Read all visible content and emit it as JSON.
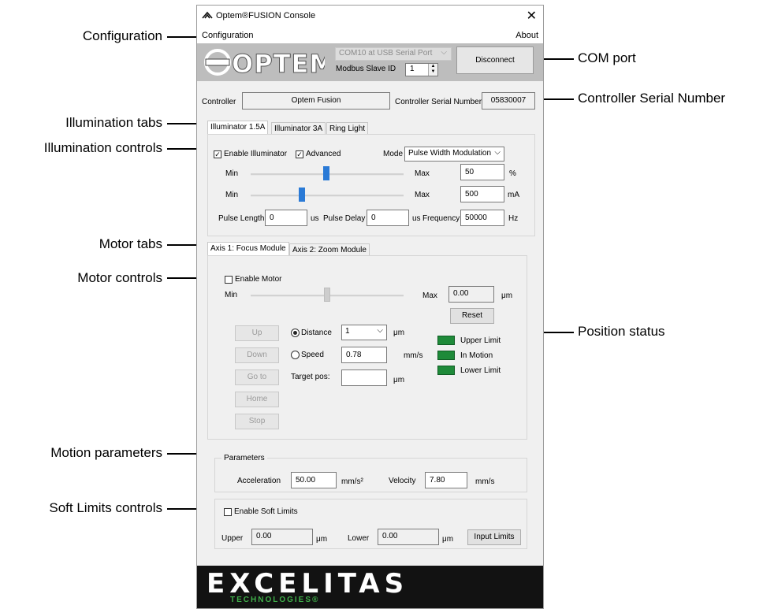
{
  "window": {
    "title": "Optem®FUSION Console",
    "close_glyph": "✕"
  },
  "menu": {
    "configuration": "Configuration",
    "about": "About"
  },
  "header": {
    "logo_text": "OPTEM",
    "com_port": "COM10 at USB Serial Port",
    "slave_id_label": "Modbus Slave ID",
    "slave_id": "1",
    "disconnect": "Disconnect"
  },
  "controller": {
    "label": "Controller",
    "value": "Optem Fusion",
    "serial_label": "Controller Serial Number",
    "serial": "05830007"
  },
  "illumination": {
    "tabs": [
      "Illuminator 1.5A",
      "Illuminator 3A",
      "Ring Light"
    ],
    "enable_label": "Enable Illuminator",
    "advanced_label": "Advanced",
    "mode_label": "Mode",
    "mode": "Pulse Width Modulation",
    "row1": {
      "min": "Min",
      "max": "Max",
      "value": "50",
      "unit": "%",
      "level": 0.5
    },
    "row2": {
      "min": "Min",
      "max": "Max",
      "value": "500",
      "unit": "mA",
      "level": 0.33
    },
    "pulse_length_label": "Pulse Length",
    "pulse_length": "0",
    "pulse_length_unit": "us",
    "pulse_delay_label": "Pulse Delay",
    "pulse_delay": "0",
    "pulse_delay_unit": "us",
    "frequency_label": "Frequency",
    "frequency": "50000",
    "frequency_unit": "Hz"
  },
  "motor": {
    "tabs": [
      "Axis 1: Focus Module",
      "Axis 2: Zoom Module"
    ],
    "enable_label": "Enable Motor",
    "min": "Min",
    "max": "Max",
    "position": "0.00",
    "position_unit": "μm",
    "reset": "Reset",
    "buttons": [
      "Up",
      "Down",
      "Go to",
      "Home",
      "Stop"
    ],
    "distance_label": "Distance",
    "distance": "1",
    "distance_unit": "μm",
    "speed_label": "Speed",
    "speed": "0.78",
    "speed_unit": "mm/s",
    "target_label": "Target pos:",
    "target": "",
    "target_unit": "μm",
    "status": [
      "Upper Limit",
      "In Motion",
      "Lower Limit"
    ]
  },
  "parameters": {
    "title": "Parameters",
    "acceleration_label": "Acceleration",
    "acceleration": "50.00",
    "acceleration_unit": "mm/s²",
    "velocity_label": "Velocity",
    "velocity": "7.80",
    "velocity_unit": "mm/s"
  },
  "soft_limits": {
    "enable_label": "Enable Soft Limits",
    "upper_label": "Upper",
    "upper": "0.00",
    "upper_unit": "μm",
    "lower_label": "Lower",
    "lower": "0.00",
    "lower_unit": "μm",
    "input_limits": "Input Limits"
  },
  "footer": {
    "brand": "EXCELITAS",
    "sub": "TECHNOLOGIES®"
  },
  "callouts": {
    "configuration": "Configuration",
    "illumination_tabs": "Illumination tabs",
    "illumination_controls": "Illumination controls",
    "motor_tabs": "Motor tabs",
    "motor_controls": "Motor controls",
    "motion_parameters": "Motion parameters",
    "soft_limits_controls": "Soft Limits controls",
    "com_port": "COM port",
    "controller_serial": "Controller Serial Number",
    "position_status": "Position status"
  }
}
